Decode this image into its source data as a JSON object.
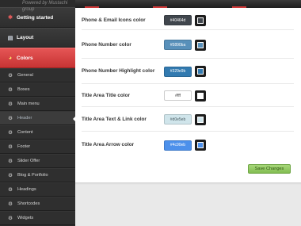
{
  "sidebar": {
    "powered_by": "Powered by Mustachi group",
    "main_items": [
      {
        "label": "Getting started",
        "icon": "magic-wand-icon"
      },
      {
        "label": "Layout",
        "icon": "layout-icon"
      },
      {
        "label": "Colors",
        "icon": "palette-icon"
      }
    ],
    "sub_items": [
      {
        "label": "General"
      },
      {
        "label": "Boxes"
      },
      {
        "label": "Main menu"
      },
      {
        "label": "Header"
      },
      {
        "label": "Content"
      },
      {
        "label": "Footer"
      },
      {
        "label": "Slider Offer"
      },
      {
        "label": "Blog & Portfolio"
      },
      {
        "label": "Headings"
      },
      {
        "label": "Shortcodes"
      },
      {
        "label": "Widgets"
      }
    ],
    "active_section": "Colors",
    "current_sub_item": "Header"
  },
  "options": [
    {
      "label": "Phone & Email Icons color",
      "value": "#40464d",
      "swatch": "#40464d"
    },
    {
      "label": "Phone Number color",
      "value": "#5890ba",
      "swatch": "#5890ba"
    },
    {
      "label": "Phone Number Highlight color",
      "value": "#329e9b",
      "swatch": "#327ab0"
    },
    {
      "label": "Title Area Title color",
      "value": "#fff",
      "swatch": "#ffffff"
    },
    {
      "label": "Title Area Text & Link color",
      "value": "#d0e5eb",
      "swatch": "#d0e5eb"
    },
    {
      "label": "Title Area Arrow color",
      "value": "#4c90eb",
      "swatch": "#4c90eb"
    }
  ],
  "save_label": "Save Changes",
  "colors": {
    "accent_red": "#d13a3a",
    "sidebar_bg": "#2b2b2b",
    "save_green": "#8bc45b"
  }
}
